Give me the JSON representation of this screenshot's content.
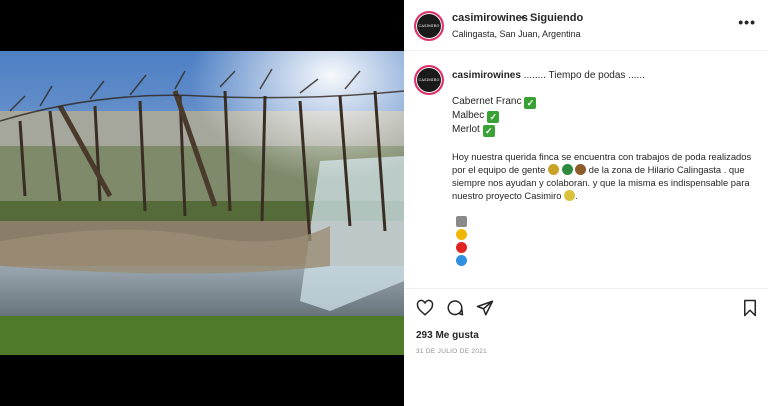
{
  "header": {
    "username": "casimirowines",
    "separator": "•",
    "follow_label": "Siguiendo",
    "location": "Calingasta, San Juan, Argentina",
    "more_label": "•••",
    "avatar_text": "CASIMIRO"
  },
  "caption": {
    "username": "casimirowines",
    "title_text": "........ Tiempo de podas ......",
    "varieties": [
      "Cabernet Franc",
      "Malbec",
      "Merlot"
    ],
    "body": "Hoy nuestra querida finca se encuentra con trabajos de poda realizados por el equipo de gente",
    "body_2": "de la zona de Hilario Calingasta . que siempre nos ayudan y colaboran. y que la misma es indispensable para nuestro proyecto Casimiro",
    "body_end": "."
  },
  "footer": {
    "likes": "293 Me gusta",
    "date": "31 DE JULIO DE 2021"
  },
  "icons": {
    "heart": "heart-icon",
    "comment": "comment-icon",
    "share": "share-icon",
    "save": "bookmark-icon"
  },
  "colors": {
    "check_green": "#3aa235",
    "text": "#262626",
    "muted": "#8e8e8e"
  }
}
